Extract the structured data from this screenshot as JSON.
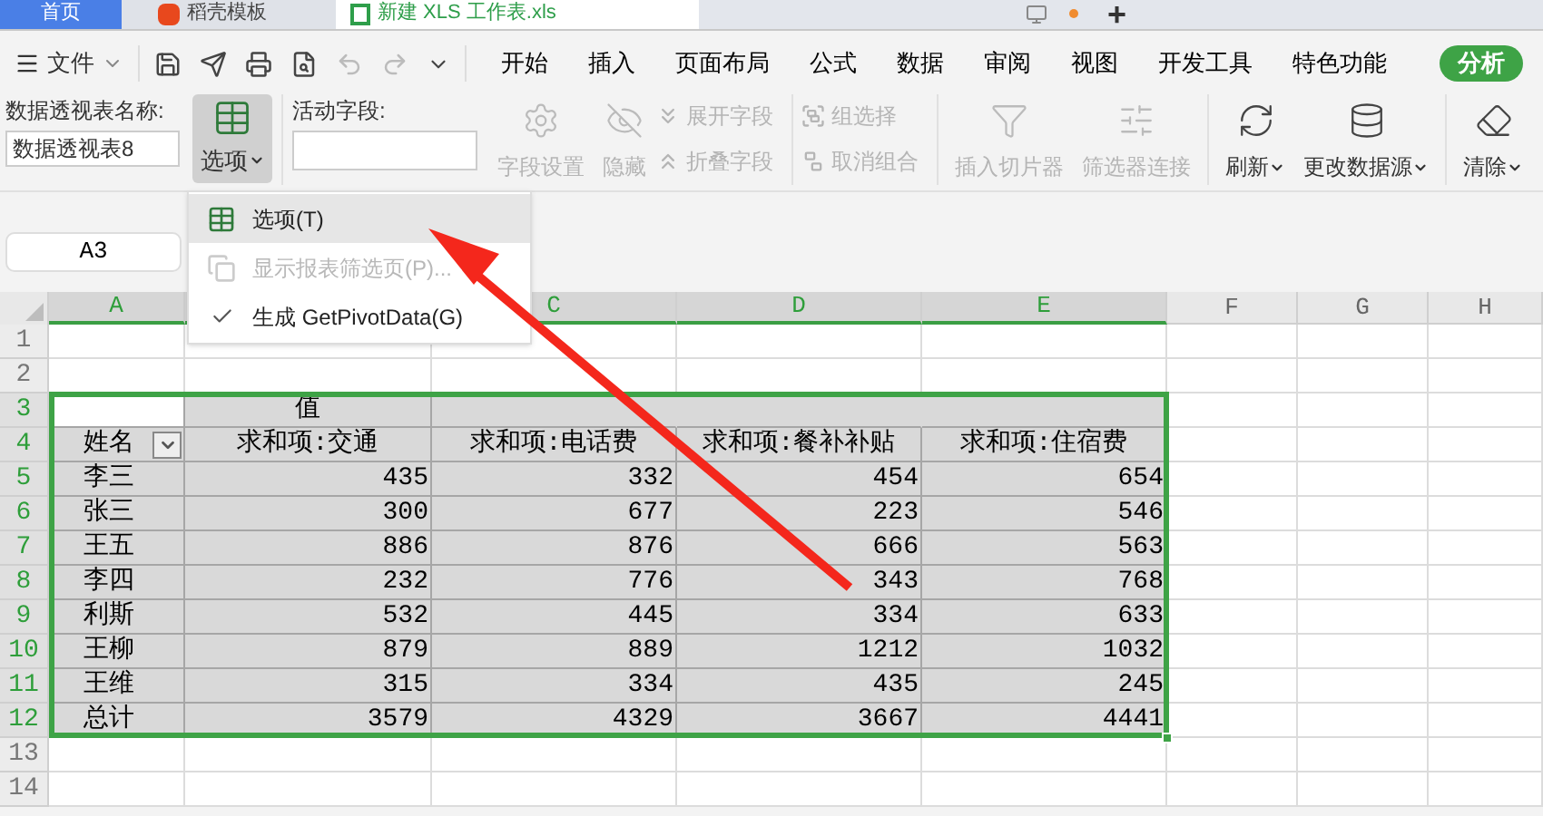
{
  "doc_tabs": [
    {
      "label": "首页",
      "selected": true
    },
    {
      "label": "稻壳模板",
      "selected": false
    },
    {
      "label": "新建 XLS 工作表.xls",
      "selected": false
    }
  ],
  "new_tab": "+",
  "menu": {
    "file": "文件",
    "tabs": [
      {
        "label": "开始",
        "selected": false
      },
      {
        "label": "插入",
        "selected": false
      },
      {
        "label": "页面布局",
        "selected": false
      },
      {
        "label": "公式",
        "selected": false
      },
      {
        "label": "数据",
        "selected": false
      },
      {
        "label": "审阅",
        "selected": false
      },
      {
        "label": "视图",
        "selected": false
      },
      {
        "label": "开发工具",
        "selected": false
      },
      {
        "label": "特色功能",
        "selected": false
      },
      {
        "label": "分析",
        "selected": true
      }
    ]
  },
  "ribbon": {
    "pivot_name_label": "数据透视表名称:",
    "pivot_name": "数据透视表8",
    "options_button": {
      "label": "选项",
      "pressed": true
    },
    "active_field_label": "活动字段:",
    "tools": [
      {
        "kind": "big",
        "label": "字段设置",
        "disabled": true,
        "dropdown": false
      },
      {
        "kind": "big",
        "label": "隐藏",
        "disabled": true,
        "dropdown": false
      },
      {
        "kind": "pair",
        "items": [
          {
            "label": "展开字段",
            "disabled": true
          },
          {
            "label": "折叠字段",
            "disabled": true
          }
        ]
      },
      {
        "kind": "pair",
        "items": [
          {
            "label": "组选择",
            "disabled": true
          },
          {
            "label": "取消组合",
            "disabled": true
          }
        ]
      },
      {
        "kind": "big",
        "label": "插入切片器",
        "disabled": true,
        "dropdown": false
      },
      {
        "kind": "big",
        "label": "筛选器连接",
        "disabled": true,
        "dropdown": false
      },
      {
        "kind": "big",
        "label": "刷新",
        "disabled": false,
        "dropdown": true
      },
      {
        "kind": "big",
        "label": "更改数据源",
        "disabled": false,
        "dropdown": true
      },
      {
        "kind": "big",
        "label": "清除",
        "disabled": false,
        "dropdown": true
      }
    ]
  },
  "options_menu": [
    {
      "label": "选项(T)",
      "selected": true,
      "disabled": false,
      "checked": false
    },
    {
      "label": "显示报表筛选页(P)...",
      "selected": false,
      "disabled": true,
      "checked": false
    },
    {
      "label": "生成 GetPivotData(G)",
      "selected": false,
      "disabled": false,
      "checked": true
    }
  ],
  "name_box": "A3",
  "sheet": {
    "columns": [
      {
        "label": "A",
        "selected": true
      },
      {
        "selected": true
      },
      {
        "label": "C",
        "selected": true
      },
      {
        "label": "D",
        "selected": true
      },
      {
        "label": "E",
        "selected": true
      },
      {
        "label": "F",
        "selected": false
      },
      {
        "label": "G",
        "selected": false
      },
      {
        "label": "H",
        "selected": false
      }
    ],
    "rows": [
      {
        "label": "1",
        "selected": false
      },
      {
        "label": "2",
        "selected": false
      },
      {
        "label": "3",
        "selected": true
      },
      {
        "label": "4",
        "selected": true
      },
      {
        "label": "5",
        "selected": true
      },
      {
        "label": "6",
        "selected": true
      },
      {
        "label": "7",
        "selected": true
      },
      {
        "label": "8",
        "selected": true
      },
      {
        "label": "9",
        "selected": true
      },
      {
        "label": "10",
        "selected": true
      },
      {
        "label": "11",
        "selected": true
      },
      {
        "label": "12",
        "selected": true
      },
      {
        "label": "13",
        "selected": false
      },
      {
        "label": "14",
        "selected": false
      }
    ]
  },
  "pivot": {
    "values_header": "值",
    "row_field": "姓名",
    "headers": [
      "求和项:交通",
      "求和项:电话费",
      "求和项:餐补补贴",
      "求和项:住宿费"
    ],
    "rows": [
      {
        "name": "李三",
        "values": [
          "435",
          "332",
          "454",
          "654"
        ]
      },
      {
        "name": "张三",
        "values": [
          "300",
          "677",
          "223",
          "546"
        ]
      },
      {
        "name": "王五",
        "values": [
          "886",
          "876",
          "666",
          "563"
        ]
      },
      {
        "name": "李四",
        "values": [
          "232",
          "776",
          "343",
          "768"
        ]
      },
      {
        "name": "利斯",
        "values": [
          "532",
          "445",
          "334",
          "633"
        ]
      },
      {
        "name": "王柳",
        "values": [
          "879",
          "889",
          "1212",
          "1032"
        ]
      },
      {
        "name": "王维",
        "values": [
          "315",
          "334",
          "435",
          "245"
        ]
      },
      {
        "name": "总计",
        "values": [
          "3579",
          "4329",
          "3667",
          "4441"
        ]
      }
    ]
  }
}
